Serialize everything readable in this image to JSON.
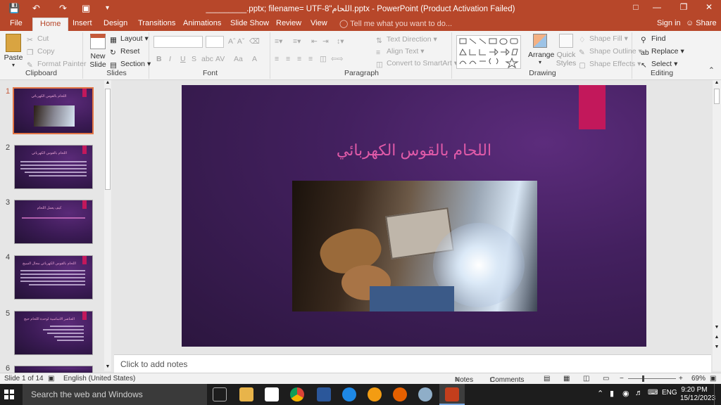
{
  "titlebar": {
    "title": "_________.pptx; filename= UTF-8\"اللحام.pptx - PowerPoint (Product Activation Failed)",
    "save_icon": "save-icon",
    "undo_icon": "undo-icon",
    "redo_icon": "redo-icon",
    "start_icon": "start-from-beginning-icon",
    "customize_icon": "customize-quick-access-icon"
  },
  "tabs": [
    "File",
    "Home",
    "Design",
    "Transitions",
    "Animations",
    "Slide Show",
    "Review",
    "View"
  ],
  "tell_me": "Tell me what you want to do...",
  "sign_in": "Sign in",
  "share": "Share",
  "ribbon": {
    "clipboard": {
      "paste": "Paste",
      "cut": "Cut",
      "copy": "Copy",
      "format_painter": "Format Painter",
      "label": "Clipboard"
    },
    "slides": {
      "new_slide": "New Slide",
      "layout": "Layout",
      "reset": "Reset",
      "section": "Section",
      "label": "Slides"
    },
    "font": {
      "bold": "B",
      "italic": "I",
      "underline": "U",
      "strike": "S",
      "shadow": "abc",
      "spacing": "AV",
      "case": "Aa",
      "color": "A",
      "label": "Font"
    },
    "paragraph": {
      "text_direction": "Text Direction",
      "align_text": "Align Text",
      "convert_smartart": "Convert to SmartArt",
      "label": "Paragraph"
    },
    "drawing": {
      "arrange": "Arrange",
      "quick_styles": "Quick Styles",
      "shape_fill": "Shape Fill",
      "shape_outline": "Shape Outline",
      "shape_effects": "Shape Effects",
      "label": "Drawing"
    },
    "editing": {
      "find": "Find",
      "replace": "Replace",
      "select": "Select",
      "label": "Editing"
    }
  },
  "thumbnails": [
    {
      "num": "1",
      "title": "اللحام بالقوس الكهربائي"
    },
    {
      "num": "2",
      "title": "اللحام بالقوس الكهربائي"
    },
    {
      "num": "3",
      "title": "كيف يعمل اللحام"
    },
    {
      "num": "4",
      "title": "اللحام بالقوس الكهربائي مجال السيج"
    },
    {
      "num": "5",
      "title": "العناصر الاساسية لوحدة اللحام حيج"
    },
    {
      "num": "6",
      "title": ""
    }
  ],
  "slide": {
    "title": "اللحام بالقوس الكهربائي"
  },
  "notes_placeholder": "Click to add notes",
  "status": {
    "slide_info": "Slide 1 of 14",
    "language": "English (United States)",
    "notes": "Notes",
    "comments": "Comments",
    "zoom": "69%"
  },
  "taskbar": {
    "search_placeholder": "Search the web and Windows",
    "lang": "ENG",
    "time": "9:20 PM",
    "date": "15/12/2023"
  },
  "colors": {
    "accent": "#b7472a",
    "slide_accent": "#c2185b",
    "title_pink": "#e05aa8"
  }
}
